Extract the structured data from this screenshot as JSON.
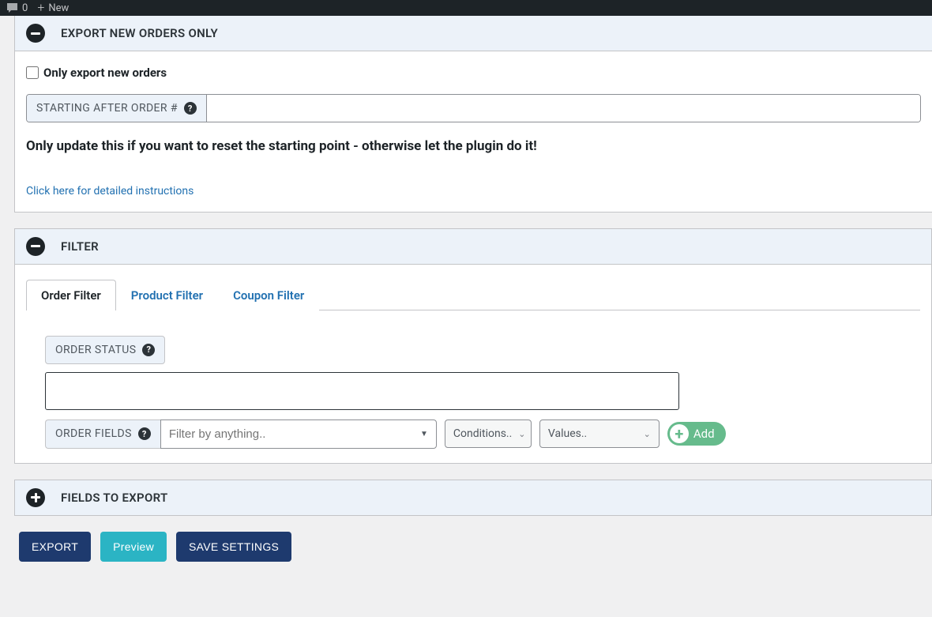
{
  "topbar": {
    "comment_count": "0",
    "new_label": "New"
  },
  "section_export_new": {
    "title": "EXPORT NEW ORDERS ONLY",
    "checkbox_label": "Only export new orders",
    "starting_after_label": "STARTING AFTER ORDER #",
    "starting_after_value": "",
    "warning": "Only update this if you want to reset the starting point - otherwise let the plugin do it!",
    "instructions_link": "Click here for detailed instructions"
  },
  "section_filter": {
    "title": "FILTER",
    "tabs": {
      "order": "Order Filter",
      "product": "Product Filter",
      "coupon": "Coupon Filter"
    },
    "order_status_label": "ORDER STATUS",
    "order_fields_label": "ORDER FIELDS",
    "filter_by_placeholder": "Filter by anything..",
    "conditions_placeholder": "Conditions..",
    "values_placeholder": "Values..",
    "add_label": "Add"
  },
  "section_fields": {
    "title": "FIELDS TO EXPORT"
  },
  "buttons": {
    "export": "EXPORT",
    "preview": "Preview",
    "save": "SAVE SETTINGS"
  }
}
